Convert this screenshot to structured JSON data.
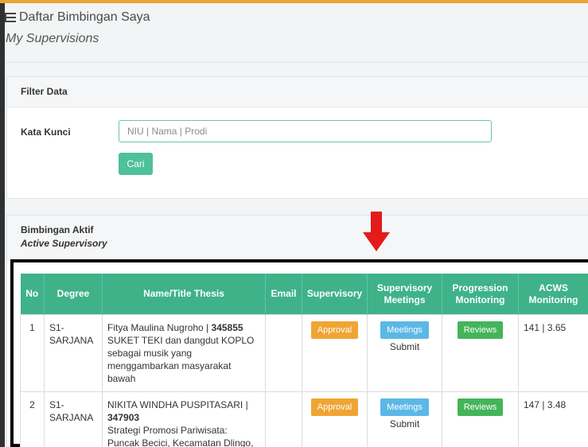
{
  "page": {
    "title": "Daftar Bimbingan Saya",
    "subtitle": "My Supervisions"
  },
  "filter": {
    "heading": "Filter Data",
    "keyword_label": "Kata Kunci",
    "keyword_placeholder": "NIU | Nama | Prodi",
    "keyword_value": "",
    "search_button": "Cari"
  },
  "active": {
    "title": "Bimbingan Aktif",
    "subtitle": "Active Supervisory"
  },
  "table": {
    "headers": [
      "No",
      "Degree",
      "Name/Title Thesis",
      "Email",
      "Supervisory",
      "Supervisory Meetings",
      "Progression Monitoring",
      "ACWS Monitoring"
    ],
    "rows": [
      {
        "no": "1",
        "degree": "S1-SARJANA",
        "name": "Fitya Maulina Nugroho | ",
        "niu": "345855",
        "thesis": "SUKET TEKI dan dangdut KOPLO sebagai musik yang menggambarkan masyarakat bawah",
        "email": "",
        "supervisory_btn": "Approval",
        "meetings_btn": "Meetings",
        "meetings_sub": "Submit",
        "progress_btn": "Reviews",
        "acws": "141 | 3.65"
      },
      {
        "no": "2",
        "degree": "S1-SARJANA",
        "name": "NIKITA WINDHA PUSPITASARI | ",
        "niu": "347903",
        "thesis": "Strategi Promosi Pariwisata: Puncak Becici, Kecamatan Dlingo, Kabupaten Bantul",
        "email": "",
        "supervisory_btn": "Approval",
        "meetings_btn": "Meetings",
        "meetings_sub": "Submit",
        "progress_btn": "Reviews",
        "acws": "147 | 3.48"
      }
    ]
  },
  "colors": {
    "accent_green": "#3fb28a",
    "approval_orange": "#f0a434",
    "meetings_blue": "#5bb8e6",
    "reviews_green": "#44b459",
    "arrow_red": "#e31b1b"
  }
}
